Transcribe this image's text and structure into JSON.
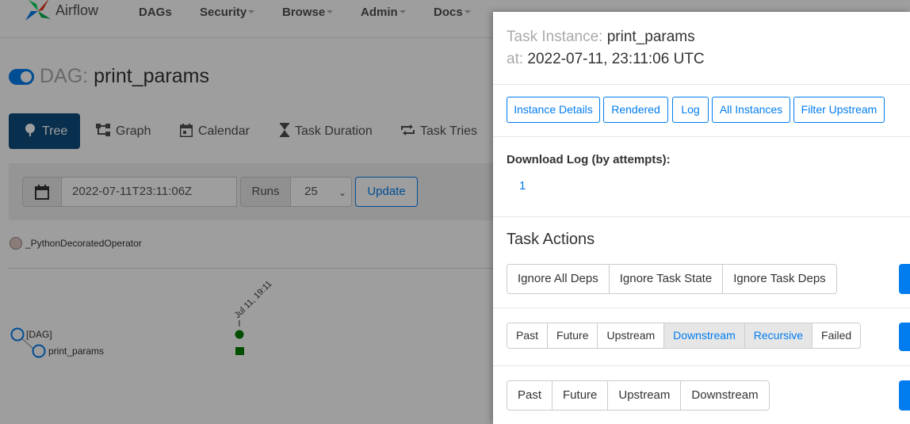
{
  "navbar": {
    "brand": "Airflow",
    "items": [
      {
        "label": "DAGs",
        "has_caret": false
      },
      {
        "label": "Security",
        "has_caret": true
      },
      {
        "label": "Browse",
        "has_caret": true
      },
      {
        "label": "Admin",
        "has_caret": true
      },
      {
        "label": "Docs",
        "has_caret": true
      }
    ]
  },
  "dag": {
    "title_label": "DAG:",
    "title": "print_params",
    "paused": false
  },
  "view_tabs": [
    {
      "label": "Tree",
      "icon": "tree-icon",
      "active": true
    },
    {
      "label": "Graph",
      "icon": "graph-icon",
      "active": false
    },
    {
      "label": "Calendar",
      "icon": "calendar-icon",
      "active": false
    },
    {
      "label": "Task Duration",
      "icon": "hourglass-icon",
      "active": false
    },
    {
      "label": "Task Tries",
      "icon": "retry-icon",
      "active": false
    }
  ],
  "filter": {
    "date_value": "2022-07-11T23:11:06Z",
    "runs_label": "Runs",
    "runs_value": "25",
    "update_label": "Update"
  },
  "legend": {
    "operator": "_PythonDecoratedOperator"
  },
  "tree": {
    "column_date": "Jul 11, 19:11",
    "nodes": [
      {
        "label": "[DAG]"
      },
      {
        "label": "print_params"
      }
    ]
  },
  "modal": {
    "task_instance_label": "Task Instance:",
    "task_instance": "print_params",
    "at_label": "at:",
    "at_value": "2022-07-11, 23:11:06 UTC",
    "tabs": [
      "Instance Details",
      "Rendered",
      "Log",
      "All Instances",
      "Filter Upstream"
    ],
    "download_title": "Download Log (by attempts):",
    "download_attempts": [
      "1"
    ],
    "task_actions_title": "Task Actions",
    "ignore_buttons": [
      "Ignore All Deps",
      "Ignore Task State",
      "Ignore Task Deps"
    ],
    "clear_options": [
      {
        "label": "Past",
        "active": false
      },
      {
        "label": "Future",
        "active": false
      },
      {
        "label": "Upstream",
        "active": false
      },
      {
        "label": "Downstream",
        "active": true
      },
      {
        "label": "Recursive",
        "active": true
      },
      {
        "label": "Failed",
        "active": false
      }
    ],
    "mark_options": [
      "Past",
      "Future",
      "Upstream",
      "Downstream"
    ]
  },
  "colors": {
    "accent": "#017cee",
    "active_tab": "#0d4d7f",
    "success": "#008000"
  }
}
